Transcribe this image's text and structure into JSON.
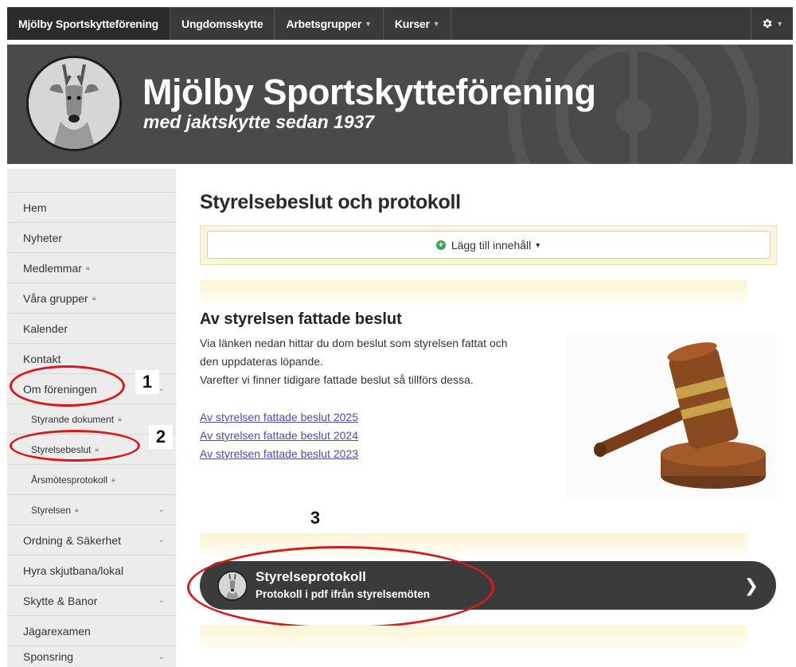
{
  "topnav": {
    "items": [
      {
        "label": "Mjölby Sportskytteförening"
      },
      {
        "label": "Ungdomsskytte"
      },
      {
        "label": "Arbetsgrupper"
      },
      {
        "label": "Kurser"
      }
    ],
    "settings_icon": "gear-icon"
  },
  "banner": {
    "title": "Mjölby Sportskytteförening",
    "subtitle": "med jaktskytte sedan 1937"
  },
  "sidebar": {
    "items": [
      {
        "label": "Hem"
      },
      {
        "label": "Nyheter"
      },
      {
        "label": "Medlemmar"
      },
      {
        "label": "Våra grupper"
      },
      {
        "label": "Kalender"
      },
      {
        "label": "Kontakt"
      },
      {
        "label": "Om föreningen"
      },
      {
        "label": "Styrande dokument"
      },
      {
        "label": "Styrelsebeslut"
      },
      {
        "label": "Årsmötesprotokoll"
      },
      {
        "label": "Styrelsen"
      },
      {
        "label": "Ordning & Säkerhet"
      },
      {
        "label": "Hyra skjutbana/lokal"
      },
      {
        "label": "Skytte & Banor"
      },
      {
        "label": "Jägarexamen"
      },
      {
        "label": "Sponsring"
      }
    ]
  },
  "annotations": {
    "n1": "1",
    "n2": "2",
    "n3": "3"
  },
  "main": {
    "page_title": "Styrelsebeslut och protokoll",
    "add_content_label": "Lägg till innehåll",
    "section": {
      "title": "Av styrelsen fattade beslut",
      "lines": [
        "Via länken nedan hittar du dom beslut som styrelsen fattat och",
        "den uppdateras löpande.",
        "Varefter vi finner tidigare fattade beslut så tillförs dessa."
      ],
      "links": [
        "Av styrelsen fattade beslut 2025",
        "Av styrelsen fattade beslut 2024",
        "Av styrelsen fattade beslut 2023"
      ]
    },
    "protocol": {
      "title": "Styrelseprotokoll",
      "subtitle": "Protokoll i pdf ifrån styrelsemöten"
    }
  },
  "colors": {
    "nav_bg": "#3a3a3a",
    "banner_bg": "#4a4a4a",
    "annotation_red": "#d41a1a",
    "link": "#4a4ea6"
  }
}
